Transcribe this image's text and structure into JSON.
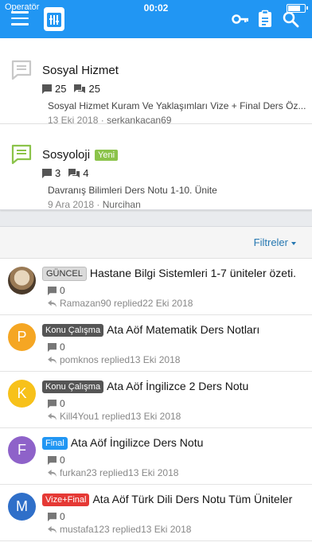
{
  "status_bar": {
    "carrier": "Operatör",
    "time": "00:02"
  },
  "colors": {
    "brand": "#2196f3",
    "new_badge": "#8bc34a",
    "link": "#2577b1"
  },
  "top_icons": [
    "menu-icon",
    "app-logo-icon",
    "key-icon",
    "clipboard-icon",
    "search-icon"
  ],
  "nodes": [
    {
      "title": "Sosyal Hizmet",
      "new_label": "",
      "discussions": "25",
      "messages": "25",
      "last_thread": "Sosyal Hizmet Kuram Ve Yaklaşımları Vize + Final Ders Öz...",
      "date": "13 Eki 2018",
      "user": "serkankacan69",
      "unread": false
    },
    {
      "title": "Sosyoloji",
      "new_label": "Yeni",
      "discussions": "3",
      "messages": "4",
      "last_thread": "Davranış Bilimleri Ders Notu 1-10. Ünite",
      "date": "9 Ara 2018",
      "user": "Nurcihan",
      "unread": true
    }
  ],
  "filter_label": "Filtreler",
  "threads": [
    {
      "prefix": "GÜNCEL",
      "title": "Hastane Bilgi Sistemleri 1-7 üniteler özeti.",
      "replies": "0",
      "reply_text": "Ramazan90 replied22 Eki 2018",
      "avatar": "",
      "avatar_color": ""
    },
    {
      "prefix": "Konu Çalışma",
      "title": "Ata Aöf Matematik Ders Notları",
      "replies": "0",
      "reply_text": "pomknos replied13 Eki 2018",
      "avatar": "P",
      "avatar_color": "#f5a623"
    },
    {
      "prefix": "Konu Çalışma",
      "title": "Ata Aöf İngilizce 2 Ders Notu",
      "replies": "0",
      "reply_text": "Kill4You1 replied13 Eki 2018",
      "avatar": "K",
      "avatar_color": "#f7c11a"
    },
    {
      "prefix": "Final",
      "title": "Ata Aöf İngilizce Ders Notu",
      "replies": "0",
      "reply_text": "furkan23 replied13 Eki 2018",
      "avatar": "F",
      "avatar_color": "#8e62c9"
    },
    {
      "prefix": "Vize+Final",
      "title": "Ata Aöf Türk Dili Ders Notu Tüm Üniteler",
      "replies": "0",
      "reply_text": "mustafa123 replied13 Eki 2018",
      "avatar": "M",
      "avatar_color": "#2f6fc9"
    }
  ]
}
